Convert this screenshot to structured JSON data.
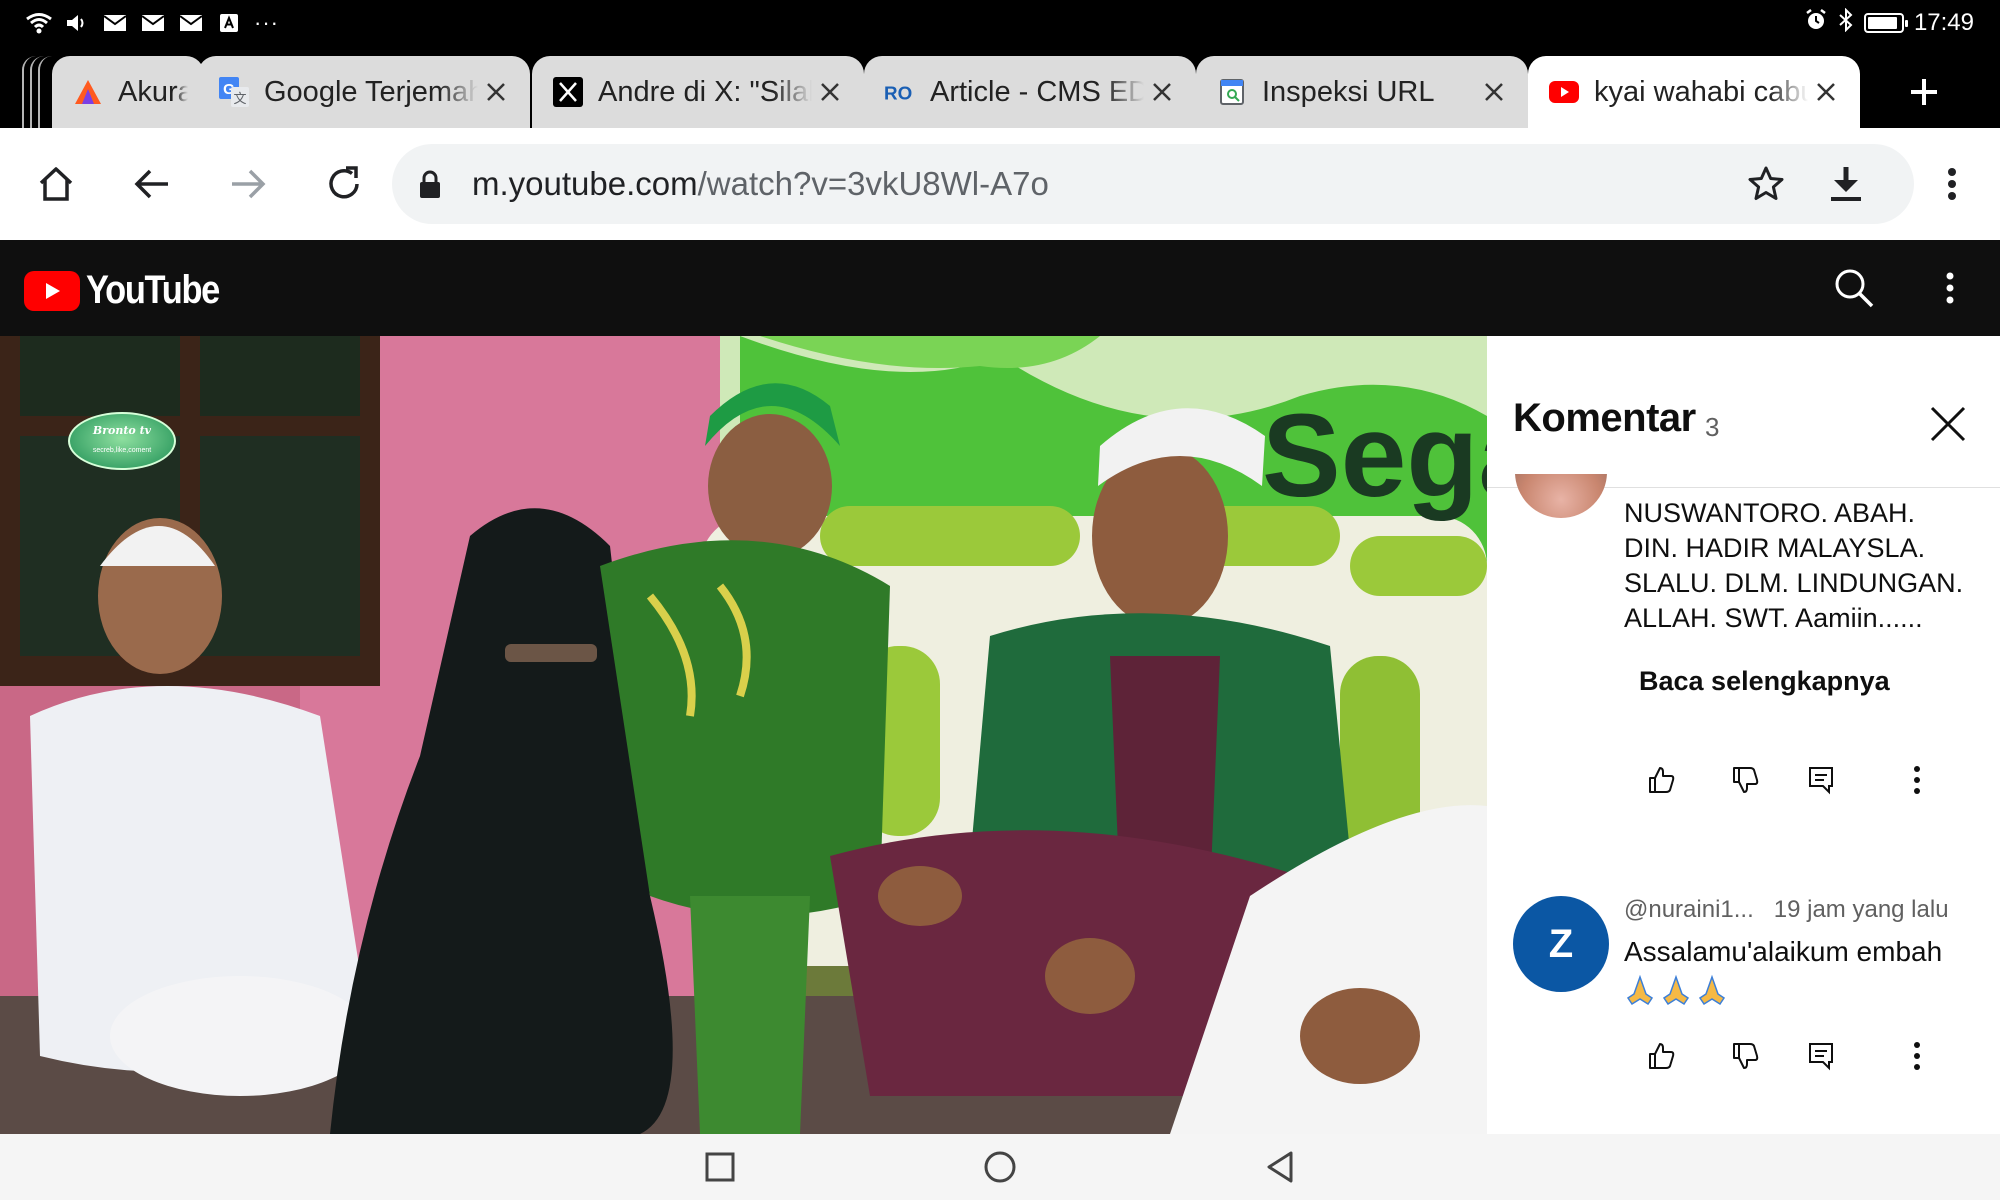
{
  "status_bar": {
    "time": "17:49",
    "left_icons": [
      "wifi-icon",
      "volume-icon",
      "mail-icon",
      "mail-icon",
      "mail-icon",
      "app-a-icon",
      "more-dots-icon"
    ],
    "right_icons": [
      "alarm-icon",
      "bluetooth-icon",
      "battery-icon"
    ],
    "overflow_dots": "···",
    "battery_level": 0.9
  },
  "tabs": [
    {
      "title": "Akurat",
      "icon": "akurat-favicon",
      "color": "#ff5a1f"
    },
    {
      "title": "Google Terjemahan",
      "icon": "google-translate-favicon",
      "color": "#4285f4"
    },
    {
      "title": "Andre di X: \"Silakan",
      "icon": "x-favicon",
      "color": "#000000"
    },
    {
      "title": "Article - CMS EDITOR",
      "icon": "ro-favicon",
      "color": "#1a5fb4"
    },
    {
      "title": "Inspeksi URL",
      "icon": "search-console-favicon",
      "color": "#4285f4"
    },
    {
      "title": "kyai wahabi cabul",
      "icon": "youtube-favicon",
      "color": "#ff0000",
      "active": true
    }
  ],
  "toolbar": {
    "url_host": "m.youtube.com",
    "url_path": "/watch?v=3vkU8Wl-A7o"
  },
  "youtube": {
    "logo_text": "YouTube",
    "brand_color": "#ff0000"
  },
  "video": {
    "overlay_text": "Sega",
    "channel_badge_top": "Bronto tv",
    "channel_badge_bottom": "secreb,like,coment"
  },
  "comments": {
    "title": "Komentar",
    "count": "3",
    "first_comment_lines": [
      "NUSWANTORO. ABAH.",
      "DIN. HADIR MALAYSLA.",
      "SLALU. DLM. LINDUNGAN.",
      "ALLAH. SWT. Aamiin......"
    ],
    "read_more": "Baca selengkapnya",
    "second_comment": {
      "avatar_letter": "Z",
      "avatar_color": "#0b57a4",
      "author": "@nuraini1...",
      "time": "19 jam yang lalu",
      "text": "Assalamu'alaikum embah",
      "emoji": "🙏🙏🙏"
    }
  }
}
